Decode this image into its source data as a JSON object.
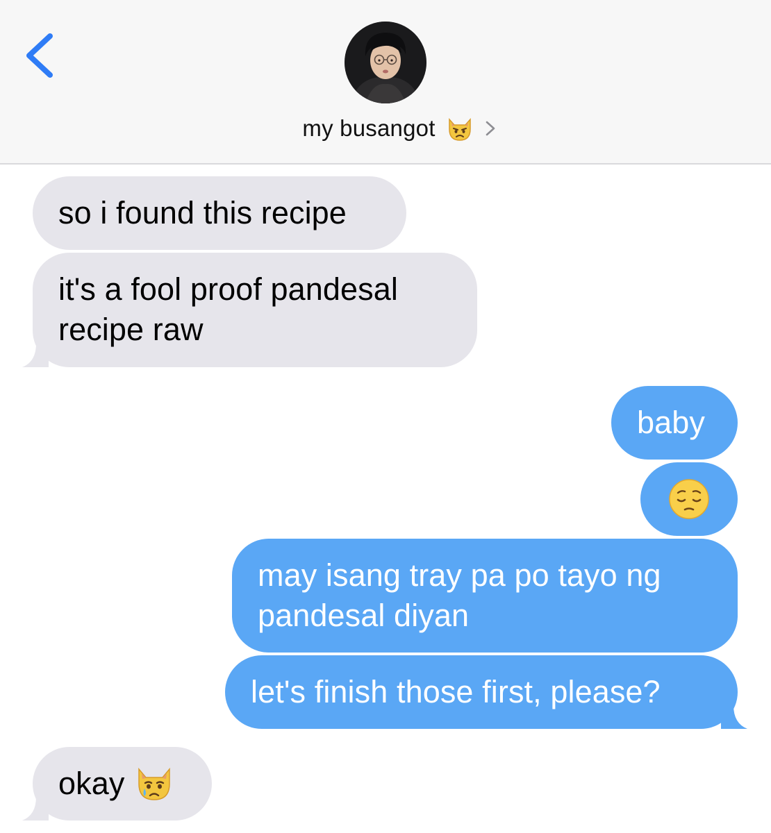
{
  "header": {
    "contact_name": "my busangot",
    "contact_emoji": "pouting-cat-emoji",
    "back_icon": "chevron-left-icon",
    "details_icon": "chevron-right-icon"
  },
  "messages": [
    {
      "id": 1,
      "direction": "received",
      "text": "so i found this recipe"
    },
    {
      "id": 2,
      "direction": "received",
      "text": "it's a fool proof pandesal recipe raw"
    },
    {
      "id": 3,
      "direction": "sent",
      "text": "baby"
    },
    {
      "id": 4,
      "direction": "sent",
      "emoji": "pensive-face-emoji"
    },
    {
      "id": 5,
      "direction": "sent",
      "text": "may isang tray pa po tayo ng pandesal diyan"
    },
    {
      "id": 6,
      "direction": "sent",
      "text": "let's finish those first, please?"
    },
    {
      "id": 7,
      "direction": "received",
      "text": "okay",
      "emoji": "crying-cat-emoji"
    }
  ],
  "colors": {
    "sent_bubble": "#5aa7f5",
    "received_bubble": "#e6e5eb",
    "accent": "#2f7cf6",
    "header_bg": "#f7f7f7"
  }
}
